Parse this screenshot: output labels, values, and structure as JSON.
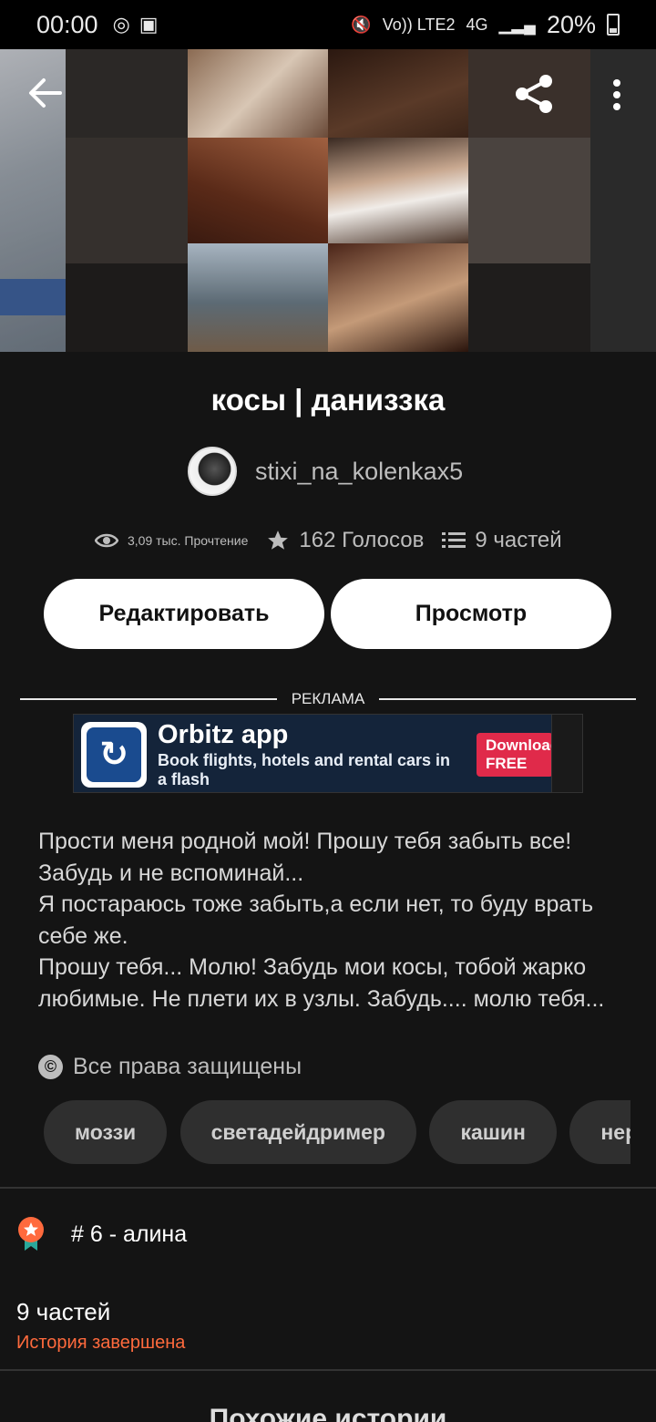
{
  "status_bar": {
    "time": "00:00",
    "network_label": "Vo)) LTE2",
    "signal_label": "4G",
    "battery_percent": "20%"
  },
  "header": {
    "back_icon": "arrow-left-icon",
    "share_icon": "share-icon",
    "more_icon": "more-vertical-icon"
  },
  "story": {
    "title": "косы | даниззка",
    "author": "stixi_na_kolenkax5",
    "reads": "3,09 тыс. Прочтение",
    "votes": "162 Голосов",
    "parts": "9 частей",
    "description": "Прости меня родной мой! Прошу тебя забыть все! Забудь и не вспоминай...\nЯ постараюсь тоже забыть,а если нет, то буду врать себе же.\nПрошу тебя... Молю! Забудь мои косы, тобой жарко любимые. Не плети их в узлы. Забудь.... молю тебя...",
    "rights": "Все права защищены"
  },
  "buttons": {
    "edit": "Редактировать",
    "view": "Просмотр"
  },
  "ad": {
    "label": "РЕКЛАМА",
    "title": "Orbitz app",
    "subtitle": "Book flights, hotels and rental cars in a flash",
    "cta": "Download FREE app"
  },
  "tags": [
    "моззи",
    "светадейдример",
    "кашин",
    "нерс"
  ],
  "ranking": {
    "text": "# 6 - алина"
  },
  "parts_section": {
    "count": "9 частей",
    "status": "История завершена"
  },
  "bottom_heading": "Похожие истории",
  "colors": {
    "background": "#141414",
    "accent_orange": "#ff6a3d",
    "button_bg": "#ffffff"
  }
}
